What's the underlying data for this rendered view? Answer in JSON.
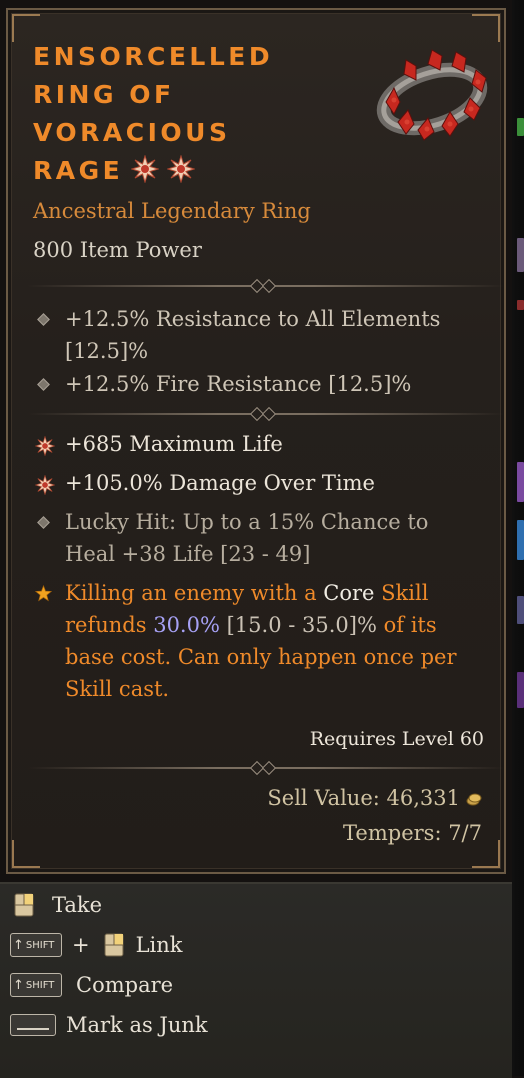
{
  "item": {
    "title_lines": [
      "Ensorcelled",
      "Ring of",
      "Voracious",
      "Rage"
    ],
    "subtype": "Ancestral Legendary Ring",
    "item_power": "800 Item Power",
    "implicits": [
      {
        "line1": "+12.5% Resistance to All Elements",
        "line2": "[12.5]%"
      },
      {
        "line1": "+12.5% Fire Resistance [12.5]%"
      }
    ],
    "affixes": [
      {
        "text": "+685 Maximum Life",
        "icon": "greater-affix-icon"
      },
      {
        "text": "+105.0% Damage Over Time",
        "icon": "greater-affix-icon"
      },
      {
        "line1": "Lucky Hit: Up to a 15% Chance to",
        "line2": "Heal +38 Life [23 - 49]",
        "icon": "diamond-bullet-icon"
      }
    ],
    "legendary_power": {
      "icon": "legendary-star-icon",
      "segments": {
        "p1": "Killing an enemy with a",
        "p2": "Core",
        "p3": "Skill",
        "p4": "refunds",
        "p5": "30.0%",
        "p6": "[15.0 - 35.0]%",
        "p7": "of its",
        "p8": "base cost. Can only happen once per",
        "p9": "Skill cast."
      }
    },
    "requires_level": "Requires Level 60",
    "sell_value": "Sell Value: 46,331",
    "tempers": "Tempers: 7/7"
  },
  "actions": [
    {
      "label": "Take",
      "keys": [
        "mouse-right-icon"
      ]
    },
    {
      "label": "Link",
      "keys": [
        "shift-key-icon",
        "mouse-right-icon"
      ],
      "joiner": "+"
    },
    {
      "label": "Compare",
      "keys": [
        "shift-key-icon"
      ]
    },
    {
      "label": "Mark as Junk",
      "keys": [
        "space-key-icon"
      ]
    }
  ],
  "key_labels": {
    "shift": "SHIFT"
  },
  "colors": {
    "legendary_orange": "#ef8a2a",
    "affix_white": "#ece5d9",
    "numeric_blue": "#a7a1f5",
    "panel_bg": "#25201c"
  }
}
